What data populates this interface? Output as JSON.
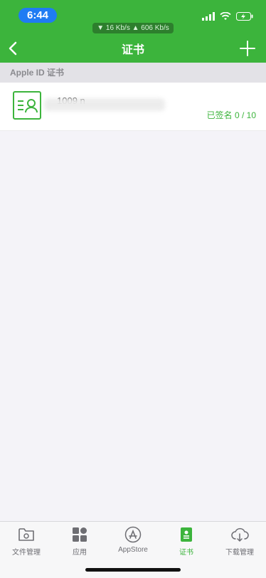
{
  "status_bar": {
    "time": "6:44",
    "network_speed": "▼ 16 Kb/s  ▲ 606 Kb/s",
    "icons": [
      "signal-icon",
      "wifi-icon",
      "battery-charging-icon"
    ]
  },
  "nav": {
    "title": "证书",
    "back_icon": "chevron-left-icon",
    "add_icon": "plus-icon"
  },
  "section": {
    "title": "Apple ID 证书"
  },
  "certificates": [
    {
      "email": "1009                        n",
      "count": "已签名 0 / 10"
    }
  ],
  "tabs": [
    {
      "label": "文件管理",
      "icon": "folder-gear-icon",
      "active": false
    },
    {
      "label": "应用",
      "icon": "apps-grid-icon",
      "active": false
    },
    {
      "label": "AppStore",
      "icon": "appstore-icon",
      "active": false
    },
    {
      "label": "证书",
      "icon": "certificate-icon",
      "active": true
    },
    {
      "label": "下载管理",
      "icon": "cloud-download-icon",
      "active": false
    }
  ],
  "colors": {
    "primary": "#3cb43c",
    "time_pill": "#1f7cf3",
    "tab_inactive": "#6e6e73"
  }
}
